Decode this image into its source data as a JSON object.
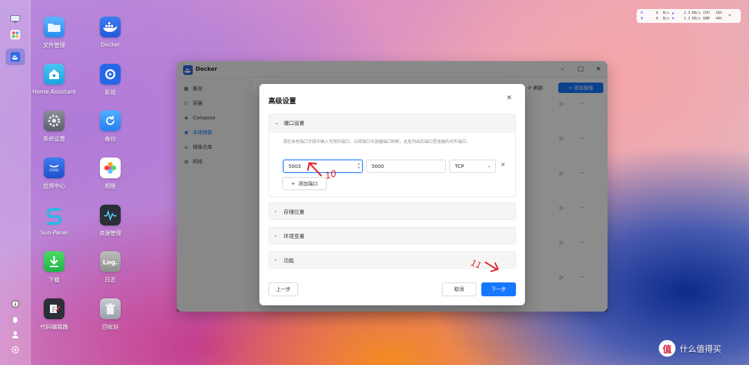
{
  "system_monitor": {
    "read_label": "R",
    "write_label": "W",
    "read_disk": "0",
    "read_disk_unit": "B/s",
    "read_net": "2.3 KB/s",
    "cpu_label": "CPU",
    "cpu_value": "18%",
    "write_disk": "0",
    "write_disk_unit": "B/s",
    "write_net": "1.3 KB/s",
    "ram_label": "RAM",
    "ram_value": "44%"
  },
  "desktop": {
    "icons": [
      {
        "label": "文件管理"
      },
      {
        "label": "Docker"
      },
      {
        "label": "Home Assistant"
      },
      {
        "label": "影视"
      },
      {
        "label": "系统设置"
      },
      {
        "label": "备份"
      },
      {
        "label": "应用中心"
      },
      {
        "label": "相册"
      },
      {
        "label": "Sun-Panel"
      },
      {
        "label": "资源管理"
      },
      {
        "label": "下载"
      },
      {
        "label": "日志"
      },
      {
        "label": "代码编辑器"
      },
      {
        "label": "回收站"
      }
    ]
  },
  "docker_window": {
    "title": "Docker",
    "nav": [
      {
        "label": "概览"
      },
      {
        "label": "容器"
      },
      {
        "label": "Compose"
      },
      {
        "label": "本地镜像"
      },
      {
        "label": "镜像仓库"
      },
      {
        "label": "网络"
      }
    ],
    "refresh_label": "刷新",
    "add_image_label": "添加镜像"
  },
  "modal": {
    "title": "高级设置",
    "port_section": {
      "title": "端口设置",
      "hint": "请在本地端口字段中输入可用的端口，以将端口与容器端口映射。此处列出的端口是容器的对外端口。",
      "local_port": "5003",
      "container_port": "5000",
      "protocol": "TCP",
      "add_port_label": "添加端口"
    },
    "sections": [
      {
        "title": "存储位置"
      },
      {
        "title": "环境变量"
      },
      {
        "title": "功能"
      }
    ],
    "prev_label": "上一步",
    "cancel_label": "取消",
    "next_label": "下一步"
  },
  "annotations": {
    "arrow_1_text": "10",
    "arrow_2_text": "11"
  },
  "watermark": {
    "logo_char": "值",
    "text": "什么值得买"
  },
  "colors": {
    "primary": "#1677ff",
    "overlay": "rgba(0,0,0,0.45)",
    "annotation": "#e0202a"
  }
}
